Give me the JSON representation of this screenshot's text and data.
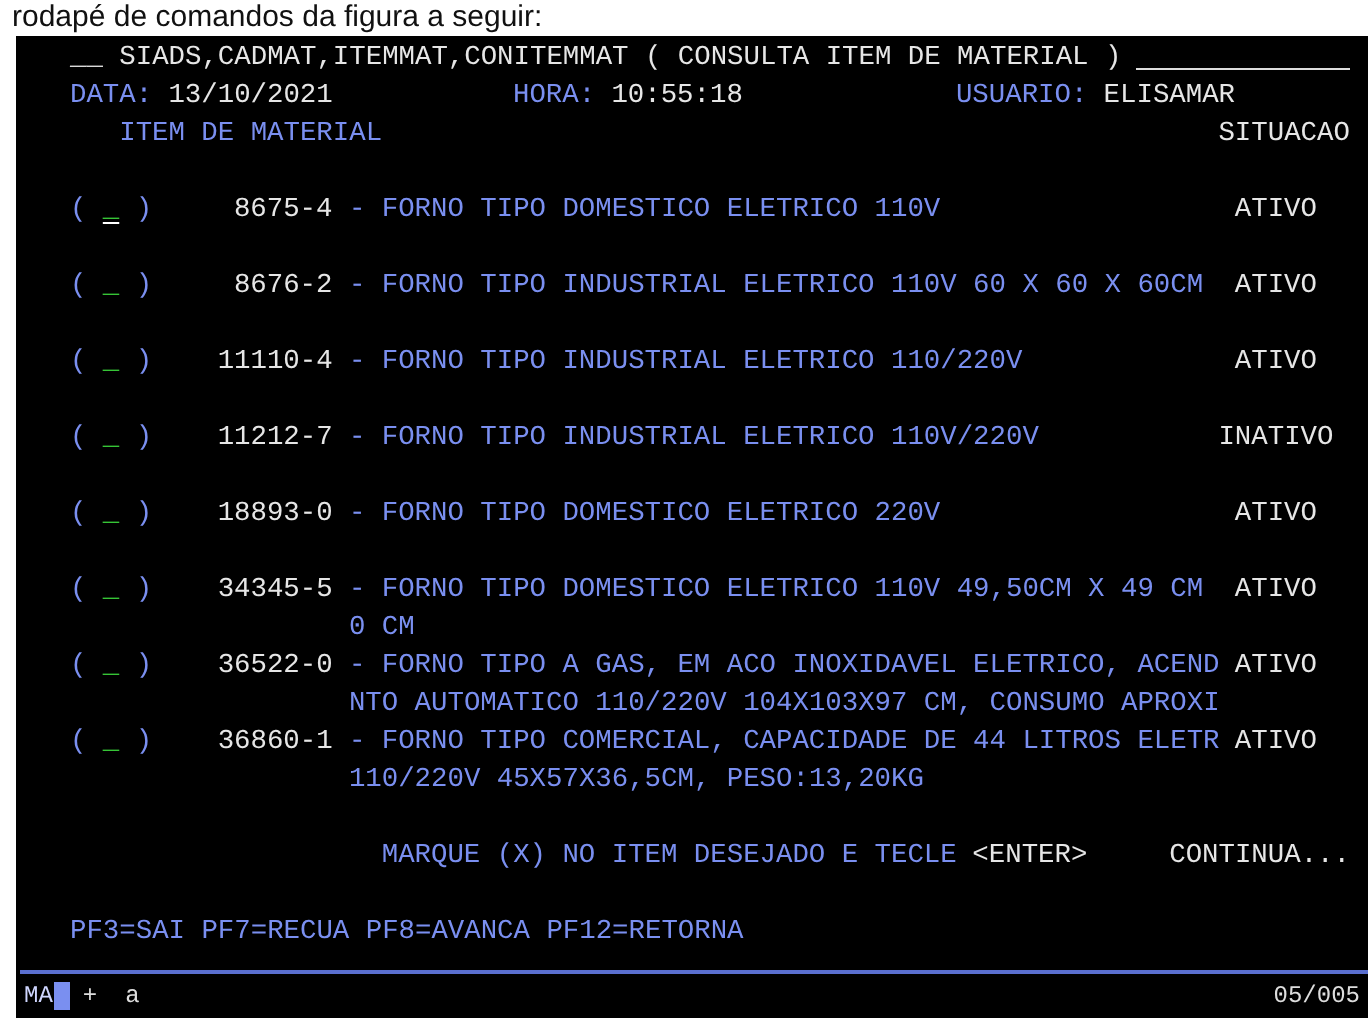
{
  "caption": "rodapé de comandos da figura a seguir:",
  "screen": {
    "title": "__ SIADS,CADMAT,ITEMMAT,CONITEMMAT ( CONSULTA ITEM DE MATERIAL )",
    "header": {
      "date_label": "DATA:",
      "date": "13/10/2021",
      "time_label": "HORA:",
      "time": "10:55:18",
      "user_label": "USUARIO:",
      "user": "ELISAMAR"
    },
    "columns": [
      "ITEM DE MATERIAL",
      "SITUACAO"
    ],
    "items": [
      {
        "open": "(",
        "field": "_",
        "close": ")",
        "cursor": true,
        "code": "8675-4",
        "separator": "-",
        "description": [
          "FORNO TIPO DOMESTICO ELETRICO 110V"
        ],
        "status": "ATIVO"
      },
      {
        "open": "(",
        "field": "_",
        "close": ")",
        "cursor": false,
        "code": "8676-2",
        "separator": "-",
        "description": [
          "FORNO TIPO INDUSTRIAL ELETRICO 110V 60 X 60 X 60CM"
        ],
        "status": "ATIVO"
      },
      {
        "open": "(",
        "field": "_",
        "close": ")",
        "cursor": false,
        "code": "11110-4",
        "separator": "-",
        "description": [
          "FORNO TIPO INDUSTRIAL ELETRICO 110/220V"
        ],
        "status": "ATIVO"
      },
      {
        "open": "(",
        "field": "_",
        "close": ")",
        "cursor": false,
        "code": "11212-7",
        "separator": "-",
        "description": [
          "FORNO TIPO INDUSTRIAL ELETRICO 110V/220V"
        ],
        "status": "INATIVO"
      },
      {
        "open": "(",
        "field": "_",
        "close": ")",
        "cursor": false,
        "code": "18893-0",
        "separator": "-",
        "description": [
          "FORNO TIPO DOMESTICO ELETRICO 220V"
        ],
        "status": "ATIVO"
      },
      {
        "open": "(",
        "field": "_",
        "close": ")",
        "cursor": false,
        "code": "34345-5",
        "separator": "-",
        "description": [
          "FORNO TIPO DOMESTICO ELETRICO 110V 49,50CM X 49 CM",
          "0 CM"
        ],
        "status": "ATIVO"
      },
      {
        "open": "(",
        "field": "_",
        "close": ")",
        "cursor": false,
        "code": "36522-0",
        "separator": "-",
        "description": [
          "FORNO TIPO A GAS, EM ACO INOXIDAVEL ELETRICO, ACEND",
          "NTO AUTOMATICO 110/220V 104X103X97 CM, CONSUMO APROXI"
        ],
        "status": "ATIVO"
      },
      {
        "open": "(",
        "field": "_",
        "close": ")",
        "cursor": false,
        "code": "36860-1",
        "separator": "-",
        "description": [
          "FORNO TIPO COMERCIAL, CAPACIDADE DE 44 LITROS ELETR",
          "110/220V 45X57X36,5CM, PESO:13,20KG"
        ],
        "status": "ATIVO"
      }
    ]
  },
  "instruction": {
    "text": "MARQUE (X) NO ITEM DESEJADO E TECLE",
    "key": "<ENTER>",
    "more": "CONTINUA..."
  },
  "function_keys": "PF3=SAI PF7=RECUA PF8=AVANCA PF12=RETORNA",
  "status_bar": {
    "mode": "MA",
    "indicator": "+",
    "input": "a",
    "page": "05/005"
  }
}
